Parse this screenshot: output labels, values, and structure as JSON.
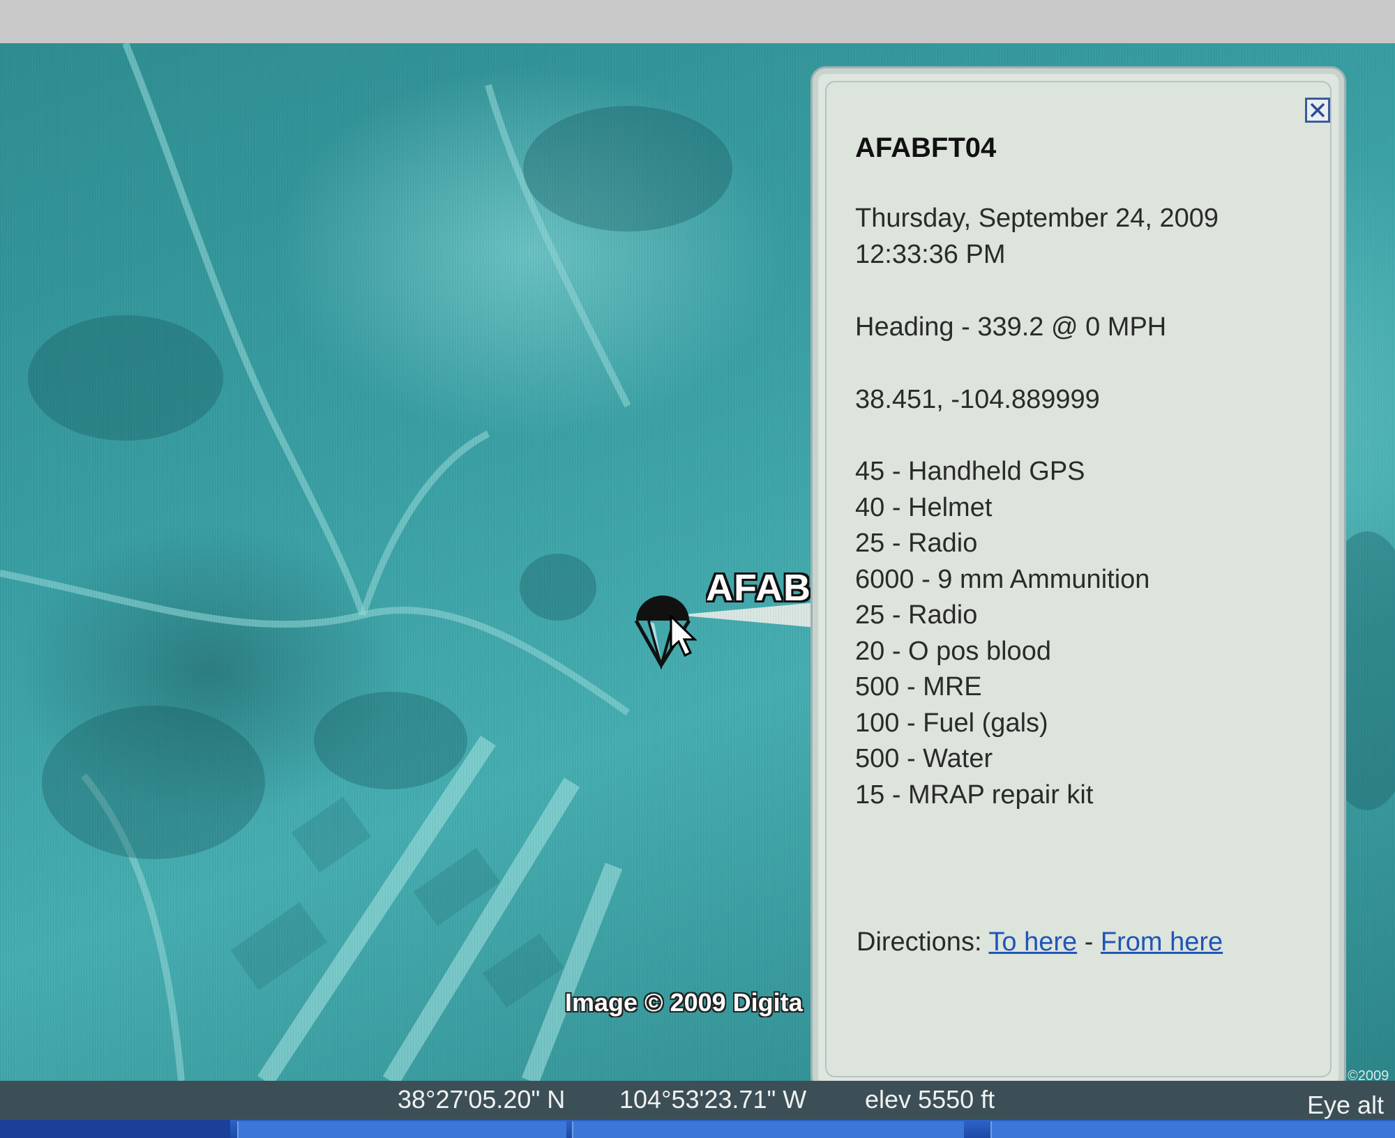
{
  "map": {
    "marker_label": "AFAB",
    "imagery_credit": "Image © 2009 Digita",
    "imagery_credit_right": "©2009"
  },
  "balloon": {
    "title": "AFABFT04",
    "date": "Thursday, September 24, 2009",
    "time": "12:33:36 PM",
    "heading": "Heading - 339.2 @ 0 MPH",
    "coordinates": "38.451, -104.889999",
    "items": [
      "45 - Handheld GPS",
      "40 - Helmet",
      "25 - Radio",
      "6000 - 9 mm Ammunition",
      "25 - Radio",
      "20 - O pos blood",
      "500 - MRE",
      "100 - Fuel (gals)",
      "500 - Water",
      "15 - MRAP repair kit"
    ],
    "directions_label": "Directions:",
    "to_here": "To here",
    "separator": "-",
    "from_here": "From here"
  },
  "statusbar": {
    "latitude": "38°27'05.20\" N",
    "longitude": "104°53'23.71\" W",
    "elevation": "elev  5550 ft",
    "eye_alt": "Eye alt"
  },
  "colors": {
    "map_teal": "#3a9fa3",
    "balloon_bg": "#dfe6df",
    "link_blue": "#1f55b8",
    "statusbar_bg": "#3c4f57",
    "taskbar_blue": "#2d63c5"
  },
  "icons": {
    "marker": "parachute-icon",
    "cursor": "mouse-pointer-icon",
    "close": "close-icon"
  }
}
